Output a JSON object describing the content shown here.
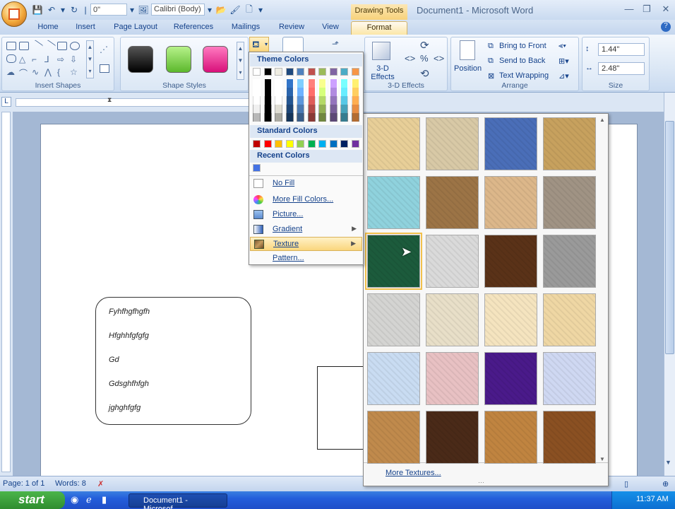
{
  "window": {
    "title": "Document1 - Microsoft Word",
    "context_tab": "Drawing Tools"
  },
  "qat": {
    "font_size_value": "0\"",
    "font_name": "Calibri (Body)"
  },
  "tabs": [
    {
      "label": "Home"
    },
    {
      "label": "Insert"
    },
    {
      "label": "Page Layout"
    },
    {
      "label": "References"
    },
    {
      "label": "Mailings"
    },
    {
      "label": "Review"
    },
    {
      "label": "View"
    },
    {
      "label": "Format"
    }
  ],
  "ribbon": {
    "groups": {
      "insert_shapes": "Insert Shapes",
      "shape_styles": "Shape Styles",
      "effects_3d": "3-D Effects",
      "arrange": "Arrange",
      "size": "Size"
    },
    "btn_3d": "3-D Effects",
    "position": "Position",
    "bring_to_front": "Bring to Front",
    "send_to_back": "Send to Back",
    "text_wrapping": "Text Wrapping",
    "height_value": "1.44\"",
    "width_value": "2.48\"",
    "style_colors": [
      "#000000",
      "#7ed148",
      "#e8208a"
    ]
  },
  "fill_menu": {
    "theme_colors_label": "Theme Colors",
    "standard_colors_label": "Standard Colors",
    "recent_colors_label": "Recent Colors",
    "theme_top": [
      "#ffffff",
      "#000000",
      "#eeece1",
      "#1f497d",
      "#4f81bd",
      "#c0504d",
      "#9bbb59",
      "#8064a2",
      "#4bacc6",
      "#f79646"
    ],
    "standard": [
      "#c00000",
      "#ff0000",
      "#ffc000",
      "#ffff00",
      "#92d050",
      "#00b050",
      "#00b0f0",
      "#0070c0",
      "#002060",
      "#7030a0"
    ],
    "recent": [
      "#4472e4"
    ],
    "items": [
      {
        "label": "No Fill"
      },
      {
        "label": "More Fill Colors..."
      },
      {
        "label": "Picture..."
      },
      {
        "label": "Gradient"
      },
      {
        "label": "Texture"
      },
      {
        "label": "Pattern..."
      }
    ]
  },
  "texture_panel": {
    "more_label": "More Textures...",
    "textures": [
      {
        "name": "papyrus",
        "color": "#e8cf98"
      },
      {
        "name": "canvas",
        "color": "#d8c9a6"
      },
      {
        "name": "denim",
        "color": "#4a6eb8"
      },
      {
        "name": "woven-mat",
        "color": "#c7a15e"
      },
      {
        "name": "water-droplets",
        "color": "#8fd2dd"
      },
      {
        "name": "paper-bag",
        "color": "#9c7446"
      },
      {
        "name": "fish-fossil",
        "color": "#dcb78a"
      },
      {
        "name": "sand",
        "color": "#a09384"
      },
      {
        "name": "green-marble",
        "color": "#1c5b3c"
      },
      {
        "name": "white-marble",
        "color": "#dadada"
      },
      {
        "name": "brown-marble",
        "color": "#5a3218"
      },
      {
        "name": "granite",
        "color": "#9a9a9a"
      },
      {
        "name": "newsprint",
        "color": "#d4d4d2"
      },
      {
        "name": "recycled-paper",
        "color": "#e8dfc8"
      },
      {
        "name": "parchment",
        "color": "#f5e4bf"
      },
      {
        "name": "stationery",
        "color": "#efd7a4"
      },
      {
        "name": "blue-tissue-paper",
        "color": "#c9dcf2"
      },
      {
        "name": "pink-tissue-paper",
        "color": "#e8c1c3"
      },
      {
        "name": "purple-mesh",
        "color": "#4a1a8a"
      },
      {
        "name": "bouquet",
        "color": "#cfd8f2"
      },
      {
        "name": "cork",
        "color": "#c08a4c"
      },
      {
        "name": "walnut",
        "color": "#4a2a18"
      },
      {
        "name": "oak",
        "color": "#c08440"
      },
      {
        "name": "medium-wood",
        "color": "#8a5022"
      }
    ]
  },
  "document": {
    "textbox_lines": [
      "Fyhfhgfhgfh",
      "Hfghhfgfgfg",
      "Gd",
      "Gdsghfhfgh",
      "jghghfgfg"
    ]
  },
  "statusbar": {
    "page": "Page: 1 of 1",
    "words": "Words: 8"
  },
  "taskbar": {
    "start": "start",
    "doc_button": "Document1 - Microsof...",
    "time": "11:37 AM"
  }
}
